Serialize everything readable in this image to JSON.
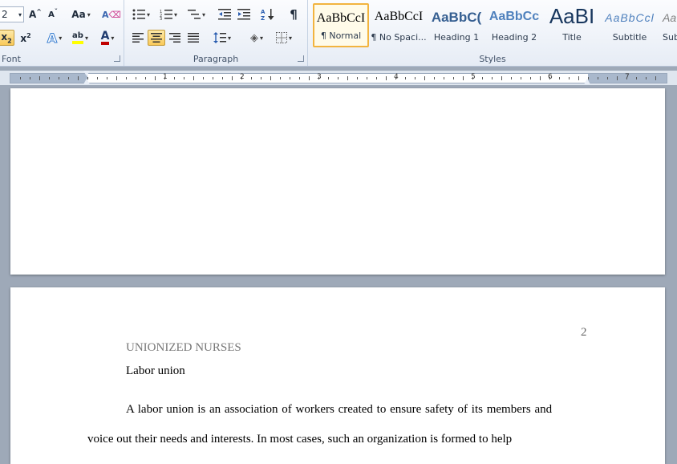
{
  "font_group": {
    "size_value": "2",
    "grow_label": "A",
    "shrink_label": "A",
    "case_label": "Aa",
    "label": "Font"
  },
  "paragraph_group": {
    "label": "Paragraph"
  },
  "styles_group": {
    "label": "Styles",
    "tiles": [
      {
        "sample": "AaBbCcI",
        "name": "¶ Normal"
      },
      {
        "sample": "AaBbCcI",
        "name": "¶ No Spaci..."
      },
      {
        "sample": "AaBbC(",
        "name": "Heading 1"
      },
      {
        "sample": "AaBbCc",
        "name": "Heading 2"
      },
      {
        "sample": "AaBI",
        "name": "Title"
      },
      {
        "sample": "AaBbCcl",
        "name": "Subtitle"
      },
      {
        "sample": "Aa",
        "name": "Sub"
      }
    ]
  },
  "ruler": {
    "numbers": [
      "1",
      "2",
      "3",
      "4",
      "5",
      "6",
      "7"
    ]
  },
  "document": {
    "page_number": "2",
    "running_head": "UNIONIZED NURSES",
    "heading": "Labor union",
    "line1": "A labor union is an association of workers created to ensure safety of its members and",
    "line2": "voice out their needs and interests. In most cases, such an organization is formed to help"
  },
  "colors": {
    "ribbon_bg": "#e6ecf5",
    "workspace": "#9ea9b8",
    "active_button": "#f9c95a",
    "heading_blue": "#365f91",
    "font_color_red": "#c00000",
    "highlight_yellow": "#ffff00"
  }
}
